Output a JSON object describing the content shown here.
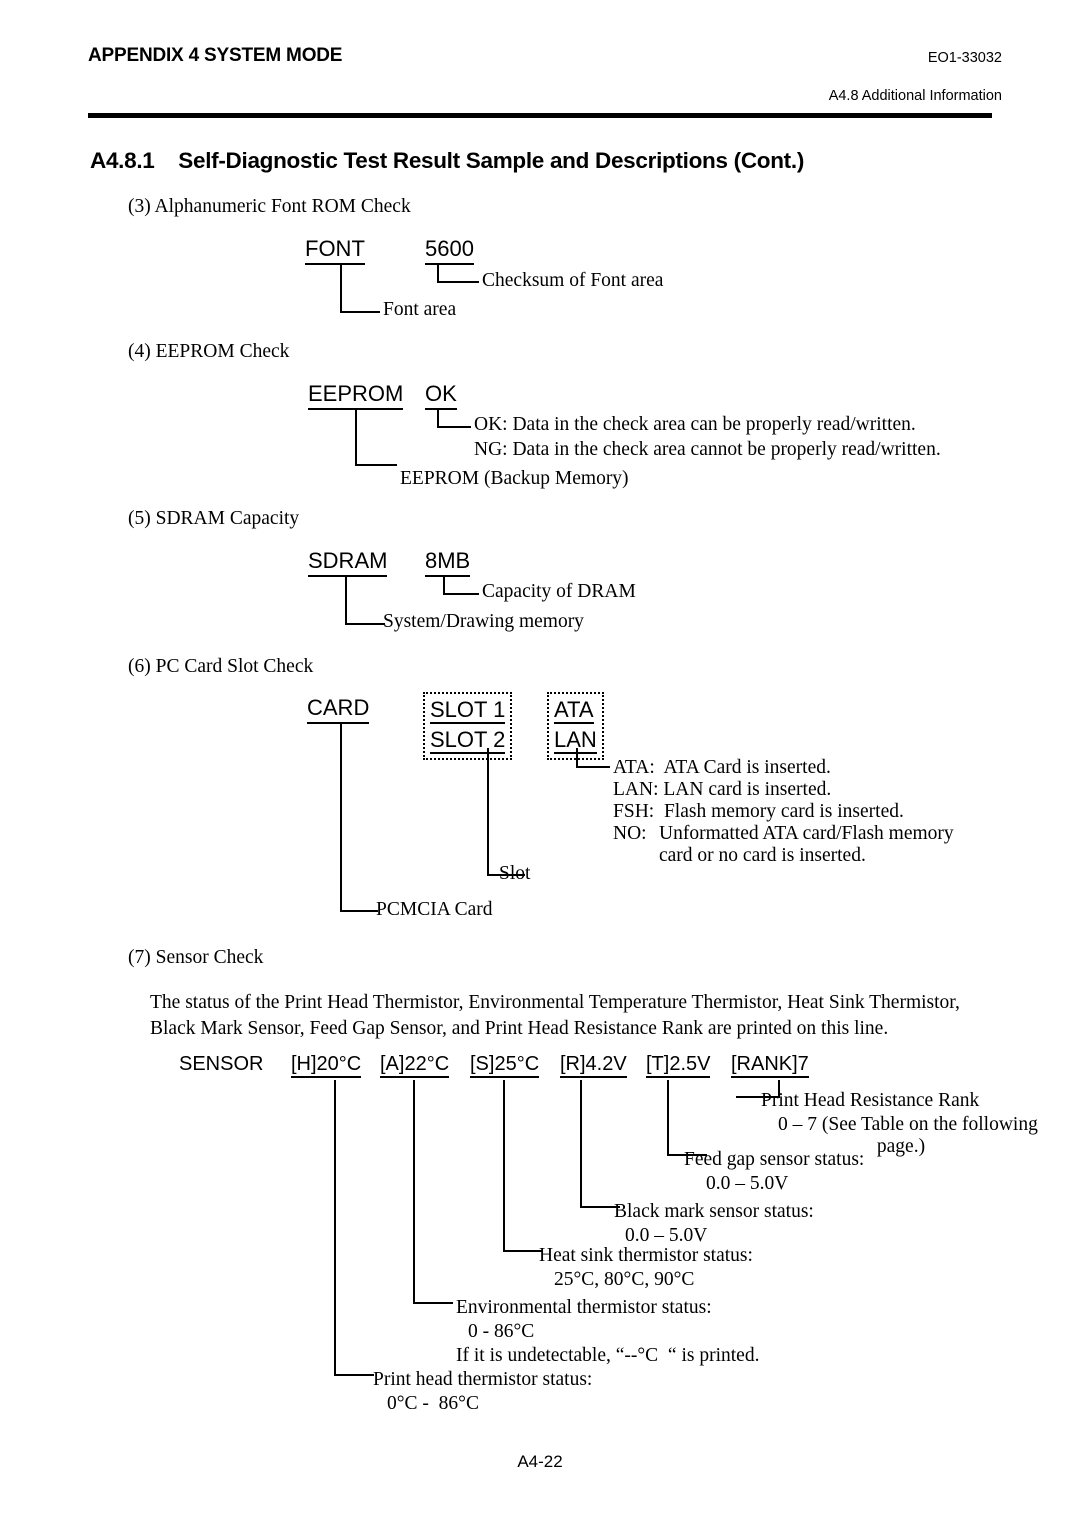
{
  "header": {
    "left_title": "APPENDIX 4 SYSTEM MODE",
    "doc_code": "EO1-33032",
    "sub_title": "A4.8 Additional Information"
  },
  "section": {
    "title": "A4.8.1    Self-Diagnostic Test Result Sample and Descriptions (Cont.)"
  },
  "items": {
    "font_rom": "(3) Alphanumeric Font ROM Check",
    "eeprom": "(4) EEPROM Check",
    "sdram": "(5) SDRAM Capacity",
    "pccard": "(6) PC Card Slot Check",
    "sensor": "(7) Sensor Check"
  },
  "font_block": {
    "label": "FONT",
    "value": "5600",
    "value_desc": "Checksum of Font area",
    "label_desc": "Font area"
  },
  "eeprom_block": {
    "label": "EEPROM",
    "value": "OK",
    "value_desc_ok": "OK: Data in the check area can be properly read/written.",
    "value_desc_ng": "NG: Data in the check area cannot be properly read/written.",
    "label_desc": "EEPROM (Backup Memory)"
  },
  "sdram_block": {
    "label": "SDRAM",
    "value": "8MB",
    "value_desc": "Capacity of DRAM",
    "label_desc": "System/Drawing memory"
  },
  "card_block": {
    "label": "CARD",
    "slot_line1": "SLOT 1",
    "slot_line2": "SLOT 2",
    "type_line1": "ATA",
    "type_line2": "LAN",
    "type_desc_ata": "ATA:  ATA Card is inserted.",
    "type_desc_lan": "LAN: LAN card is inserted.",
    "type_desc_fsh": "FSH:  Flash memory card is inserted.",
    "type_desc_no_label": "NO:",
    "type_desc_no_line1": "Unformatted  ATA  card/Flash  memory",
    "type_desc_no_line2": "card or no card is inserted.",
    "slot_desc": "Slot",
    "label_desc": "PCMCIA Card"
  },
  "sensor_block": {
    "intro_line1": "The status of the Print Head Thermistor, Environmental Temperature Thermistor, Heat Sink Thermistor,",
    "intro_line2": "Black Mark Sensor, Feed Gap Sensor, and Print Head Resistance Rank are printed on this line.",
    "label": "SENSOR",
    "tokens": [
      {
        "text": "[H]20°C"
      },
      {
        "text": "[A]22°C"
      },
      {
        "text": "[S]25°C"
      },
      {
        "text": "[R]4.2V"
      },
      {
        "text": "[T]2.5V"
      },
      {
        "text": "[RANK]7"
      }
    ],
    "rank_title": "Print Head Resistance Rank",
    "rank_range": "0 – 7 (See Table on the following",
    "rank_range_cont": "page.)",
    "feedgap_title": "Feed gap sensor status:",
    "feedgap_range": "0.0 – 5.0V",
    "blackmark_title": "Black mark sensor status:",
    "blackmark_range": "0.0 – 5.0V",
    "heatsink_title": "Heat sink thermistor status:",
    "heatsink_range": "25°C, 80°C, 90°C",
    "env_title": "Environmental thermistor status:",
    "env_range": "0 - 86°C",
    "env_note": "If it is undetectable, “--°C  “ is printed.",
    "head_title": "Print head thermistor status:",
    "head_range": "0°C -  86°C"
  },
  "footer": {
    "page_number": "A4-22"
  }
}
